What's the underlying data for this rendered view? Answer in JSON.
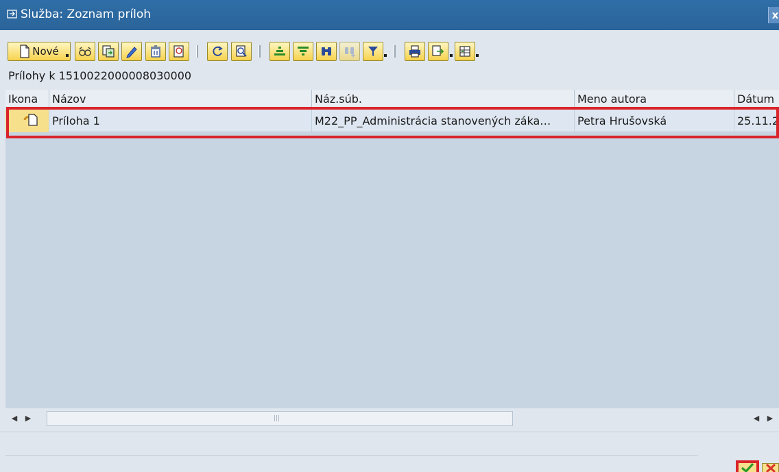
{
  "window": {
    "title": "Služba: Zoznam príloh",
    "close_icon": "close-icon"
  },
  "toolbar": {
    "new_label": "Nové",
    "buttons": [
      "new-button",
      "display-button",
      "copy-button",
      "edit-button",
      "delete-button",
      "detail-button",
      "refresh-button",
      "search-button",
      "sort-ascending-button",
      "sort-descending-button",
      "find-button",
      "find-next-button",
      "filter-button",
      "print-button",
      "export-button",
      "layout-button"
    ]
  },
  "heading": "Prílohy k 1510022000008030000",
  "table": {
    "columns": [
      "Ikona",
      "Názov",
      "Náz.súb.",
      "Meno autora",
      "Dátum"
    ],
    "rows": [
      {
        "icon": "attachment-icon",
        "name": "Príloha 1",
        "file": "M22_PP_Administrácia stanovených záka…",
        "author": "Petra Hrušovská",
        "date": "25.11.2"
      }
    ]
  },
  "colors": {
    "title_bar": "#2f6ea7",
    "highlight": "#d9242a",
    "table_bg": "#c7d5e3",
    "button_yellow": "#f6d24d"
  }
}
